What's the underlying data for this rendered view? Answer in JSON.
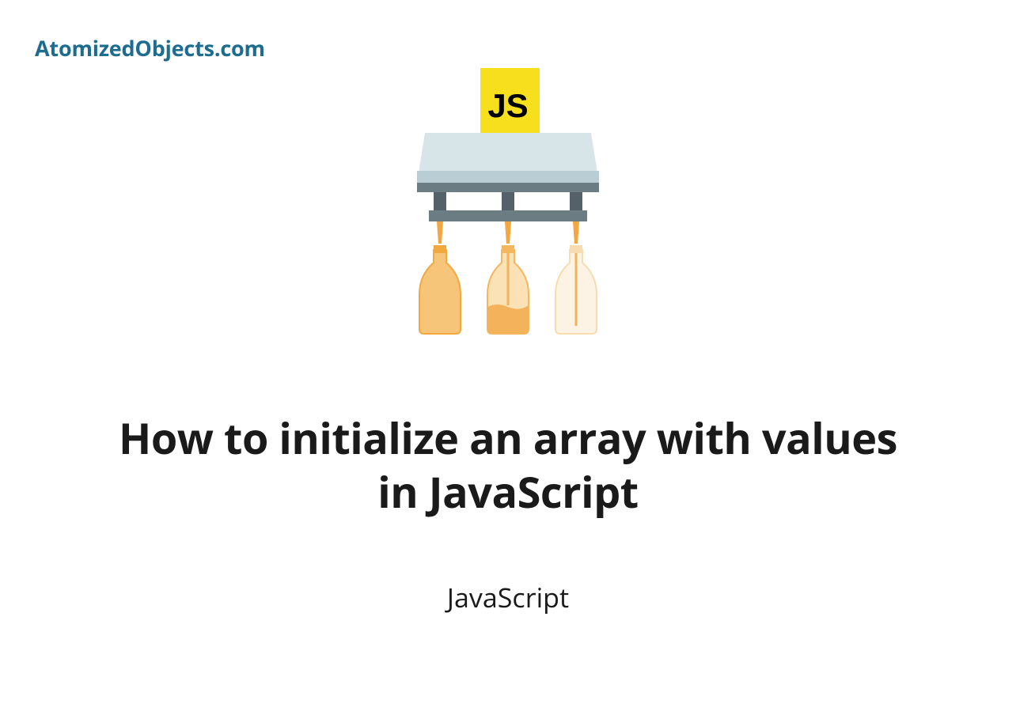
{
  "site": {
    "name": "AtomizedObjects.com"
  },
  "article": {
    "title": "How to initialize an array with values in JavaScript",
    "category": "JavaScript"
  },
  "illustration": {
    "badge_text": "JS",
    "colors": {
      "js_yellow": "#f7df1e",
      "js_text": "#000000",
      "machine_light": "#d7e5e8",
      "machine_mid": "#b9ced4",
      "machine_dark": "#6b7c82",
      "pipe_gray": "#546168",
      "nozzle_orange": "#f4a640",
      "bottle1_fill": "#f6c57a",
      "bottle1_outline": "#f1a93f",
      "bottle2_fill": "#fbe1b6",
      "bottle2_liquid": "#f4b25a",
      "bottle2_outline": "#f3b75e",
      "bottle3_fill": "#fdf3e4",
      "bottle3_outline": "#f7dcb2"
    }
  }
}
